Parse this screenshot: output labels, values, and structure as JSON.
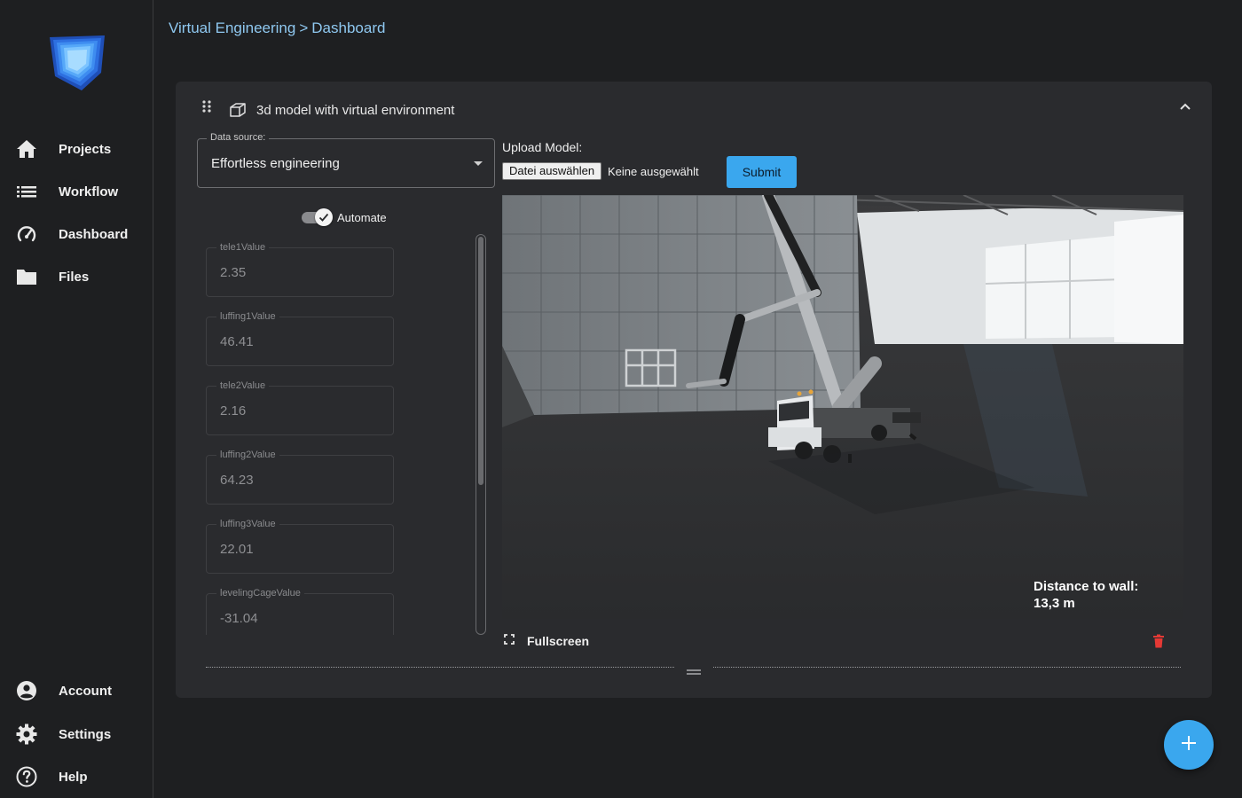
{
  "sidebar": {
    "logo": "app-logo-cube",
    "nav_top": [
      {
        "label": "Projects",
        "icon": "home-icon"
      },
      {
        "label": "Workflow",
        "icon": "list-icon"
      },
      {
        "label": "Dashboard",
        "icon": "speedometer-icon"
      },
      {
        "label": "Files",
        "icon": "folder-icon"
      }
    ],
    "nav_bottom": [
      {
        "label": "Account",
        "icon": "account-circle-icon"
      },
      {
        "label": "Settings",
        "icon": "gear-icon"
      },
      {
        "label": "Help",
        "icon": "help-icon"
      }
    ]
  },
  "breadcrumb": {
    "parent": "Virtual Engineering",
    "separator": ">",
    "current": "Dashboard"
  },
  "card": {
    "title": "3d model with virtual environment",
    "data_source": {
      "legend": "Data source:",
      "value": "Effortless engineering"
    },
    "automate": {
      "label": "Automate",
      "checked": true
    },
    "fields": [
      {
        "label": "tele1Value",
        "value": "2.35"
      },
      {
        "label": "luffing1Value",
        "value": "46.41"
      },
      {
        "label": "tele2Value",
        "value": "2.16"
      },
      {
        "label": "luffing2Value",
        "value": "64.23"
      },
      {
        "label": "luffing3Value",
        "value": "22.01"
      },
      {
        "label": "levelingCageValue",
        "value": "-31.04"
      }
    ],
    "upload": {
      "label": "Upload Model:",
      "file_button": "Datei auswählen",
      "file_status": "Keine ausgewählt",
      "submit": "Submit"
    },
    "viewport": {
      "distance_label": "Distance to wall:",
      "distance_value": "13,3 m"
    },
    "fullscreen_label": "Fullscreen"
  },
  "colors": {
    "accent": "#3aa7ee",
    "background": "#1e1f21",
    "card": "#2a2b2e",
    "link": "#8fc8f0",
    "danger": "#e53935"
  }
}
